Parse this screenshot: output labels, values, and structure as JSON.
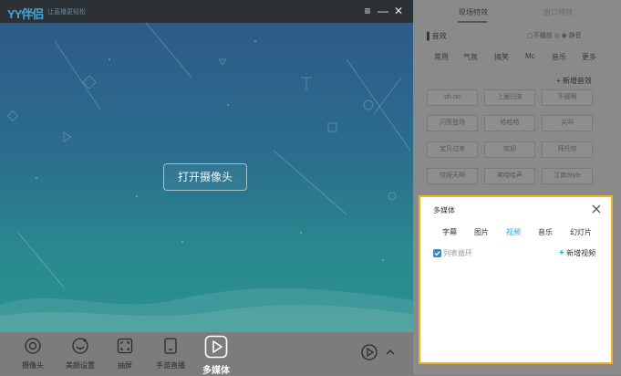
{
  "app": {
    "logo": "YY伴侣",
    "logo_subtitle": "让直播更轻松",
    "controls": [
      "≡",
      "—",
      "✕"
    ]
  },
  "stage": {
    "open_camera_label": "打开摄像头",
    "gradient": [
      "#2d5b88",
      "#2a8f8d"
    ]
  },
  "toolbar": {
    "items": [
      {
        "label": "摄像头",
        "icon": "camera-icon"
      },
      {
        "label": "美颜设置",
        "icon": "beauty-icon"
      },
      {
        "label": "抽屏",
        "icon": "screen-capture-icon"
      },
      {
        "label": "手游直播",
        "icon": "mobile-game-icon"
      },
      {
        "label": "多媒体",
        "icon": "play-icon",
        "active": true
      }
    ]
  },
  "right_panel": {
    "tabs": [
      "现场特效",
      "窗口特效"
    ],
    "section_title": "▌音效",
    "flags": "▢不播放  ◎  ◉  静音",
    "categories": [
      "常用",
      "气氛",
      "搞笑",
      "Mc",
      "音乐",
      "更多"
    ],
    "new_effect": "+ 新增音效",
    "effects": [
      [
        "oh no",
        "上届归来",
        "不服啊"
      ],
      [
        "闪亮登场",
        "哈哈哈",
        "尖叫"
      ],
      [
        "宝贝过来",
        "欢迎",
        "拜托你"
      ],
      [
        "哎呀天啊",
        "笑哈哈声",
        "江南Style"
      ]
    ]
  },
  "popup": {
    "title": "多媒体",
    "tabs": [
      "字幕",
      "图片",
      "视频",
      "音乐",
      "幻灯片"
    ],
    "active_tab": "视频",
    "loop_label": "列表循环",
    "loop_checked": true,
    "add_video_label": "新增视频",
    "border_color": "#f2b21b",
    "accent_color": "#2aa2d8"
  }
}
